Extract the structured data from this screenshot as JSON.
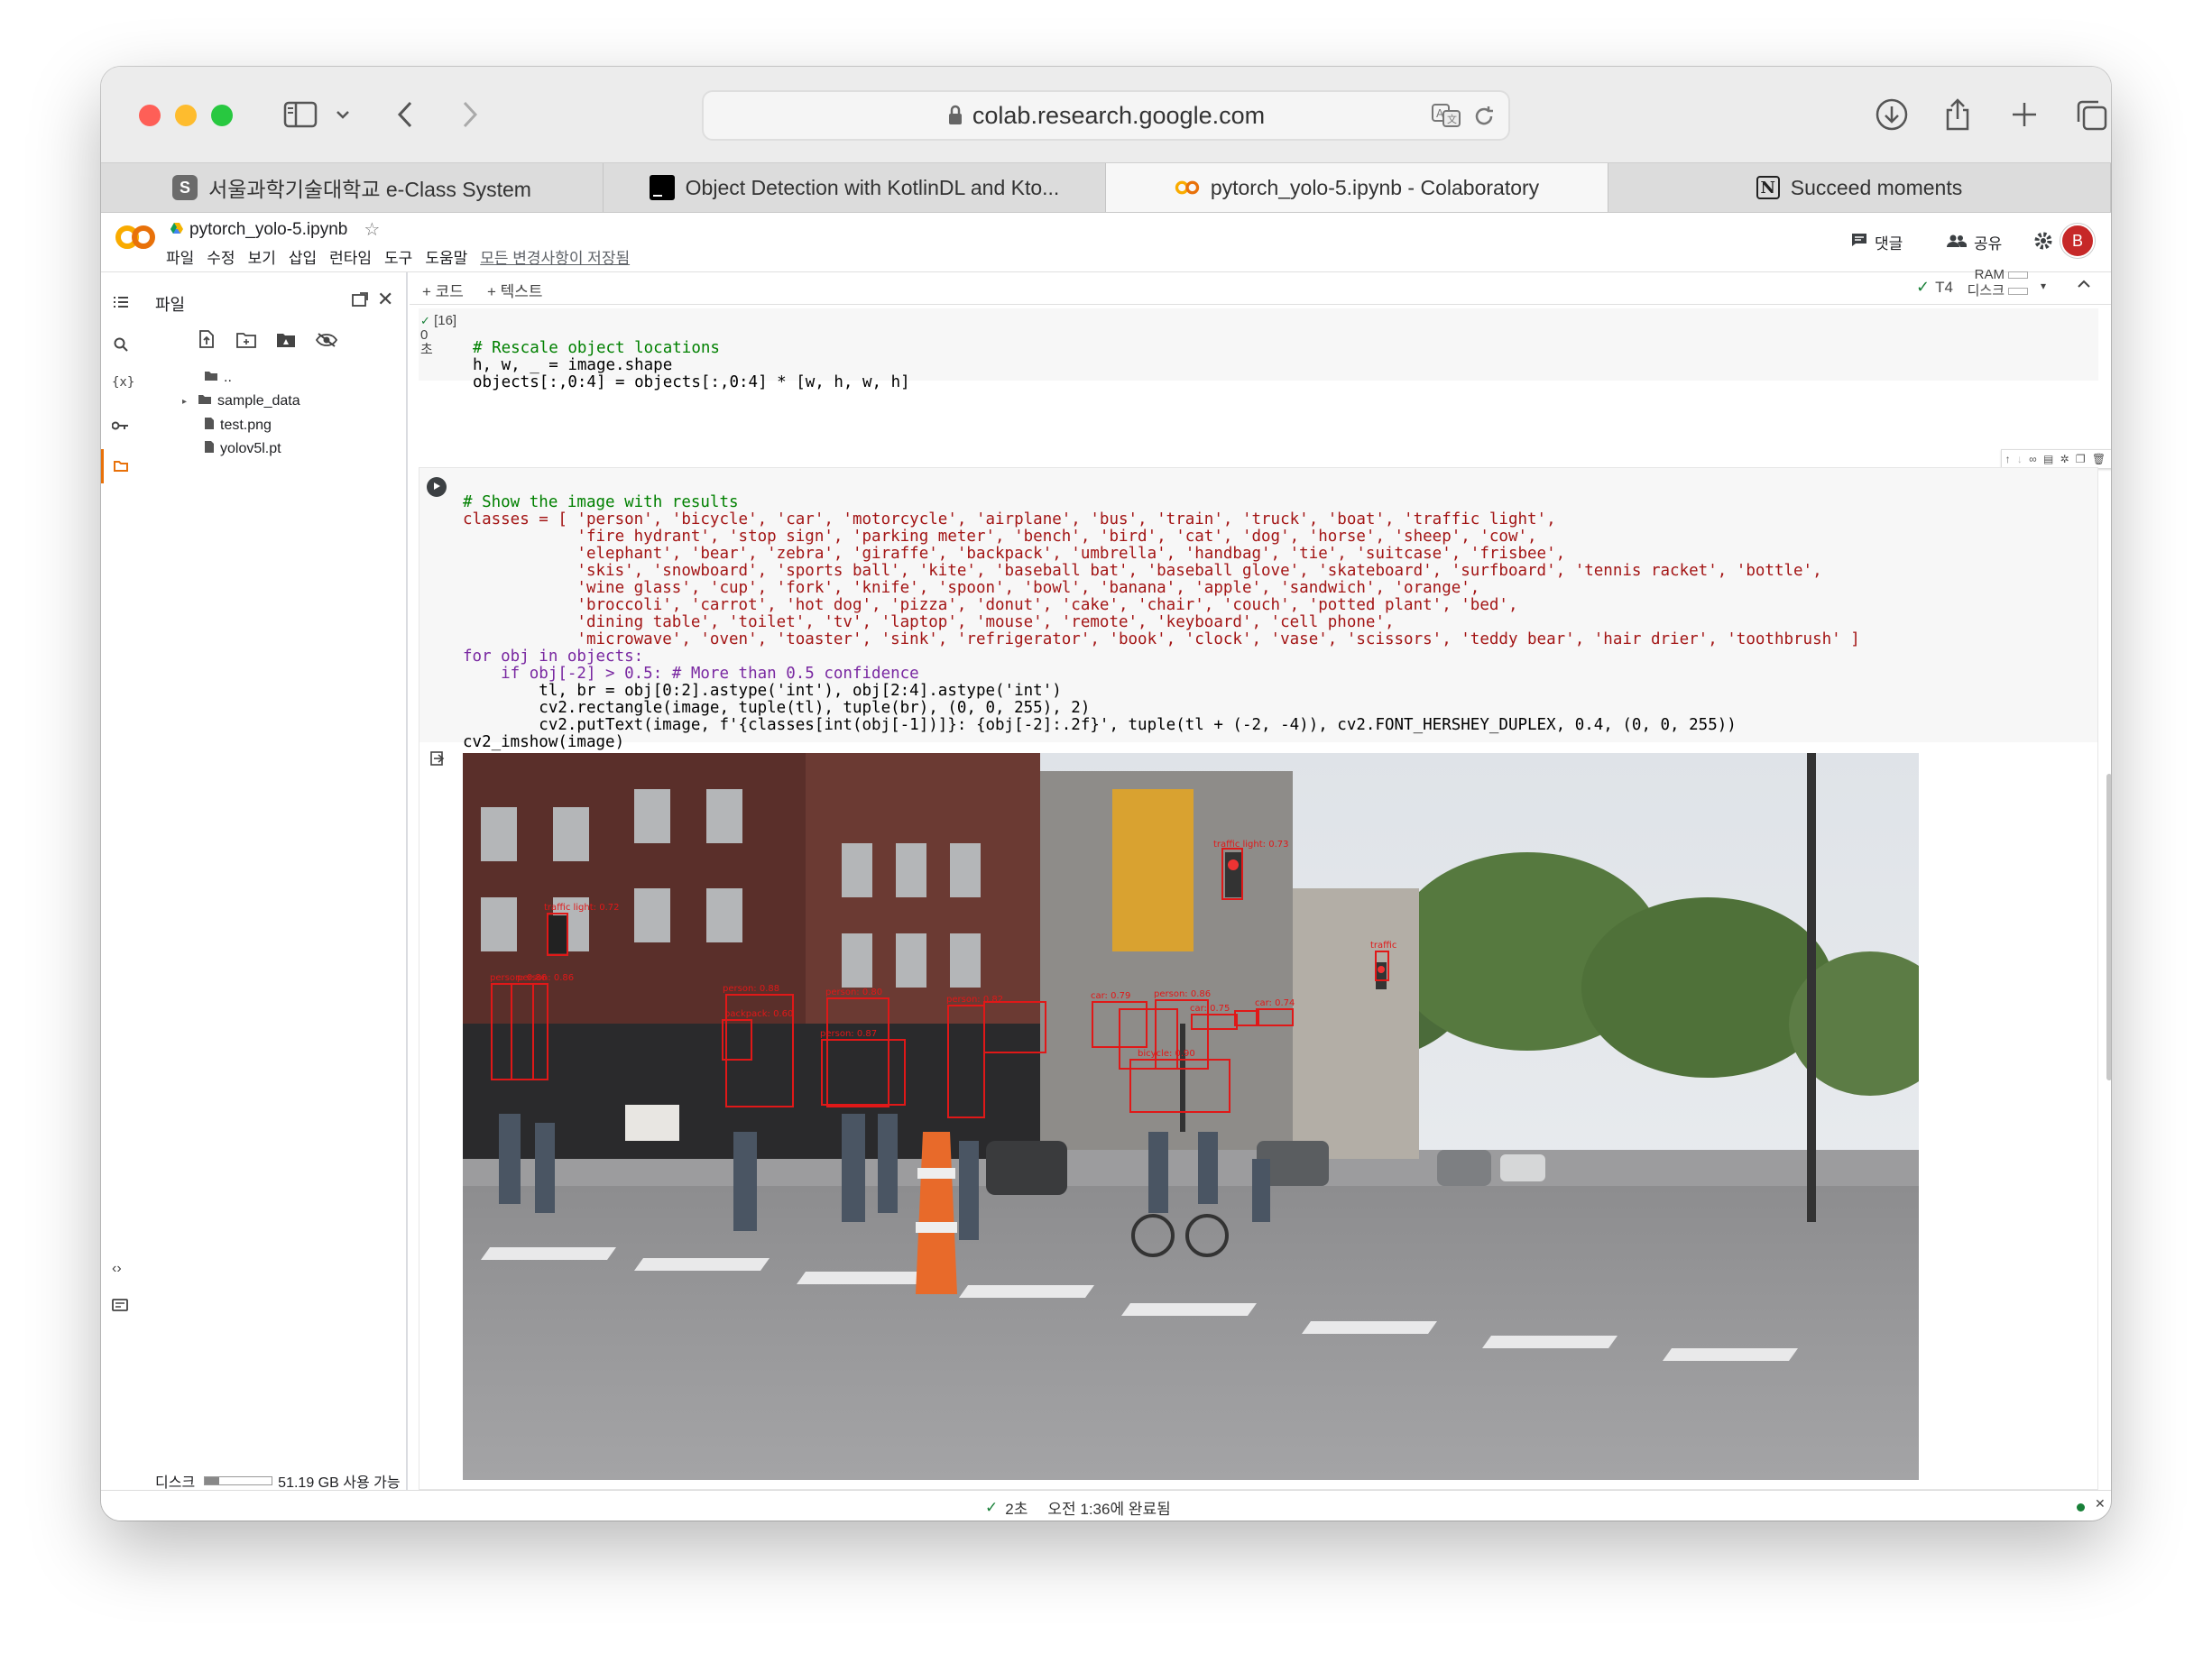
{
  "window": {
    "url": "colab.research.google.com",
    "tabs": [
      {
        "label": "서울과학기술대학교 e-Class System",
        "icon": "s-badge-icon",
        "favicon_text": "S"
      },
      {
        "label": "Object Detection with KotlinDL and Kto...",
        "icon": "terminal-icon"
      },
      {
        "label": "pytorch_yolo-5.ipynb - Colaboratory",
        "icon": "colab-icon"
      },
      {
        "label": "Succeed moments",
        "icon": "notion-icon"
      }
    ]
  },
  "colab": {
    "logo": "CO",
    "notebook_name": "pytorch_yolo-5.ipynb",
    "menu": [
      "파일",
      "수정",
      "보기",
      "삽입",
      "런타임",
      "도구",
      "도움말"
    ],
    "save_status": "모든 변경사항이 저장됨",
    "comment_label": "댓글",
    "share_label": "공유",
    "avatar_letter": "B",
    "add_code": "+ 코드",
    "add_text": "+ 텍스트",
    "runtime": "T4",
    "ram_label": "RAM",
    "disk_label": "디스크"
  },
  "sidebar": {
    "title": "파일",
    "tree": [
      {
        "label": "..",
        "icon": "folder-up-icon"
      },
      {
        "label": "sample_data",
        "icon": "folder-icon"
      },
      {
        "label": "test.png",
        "icon": "file-icon"
      },
      {
        "label": "yolov5l.pt",
        "icon": "file-icon"
      }
    ],
    "disk_label": "디스크",
    "disk_free": "51.19 GB 사용 가능",
    "disk_used_fraction": 0.22
  },
  "cell1": {
    "exec_count": "[16]",
    "duration": "0",
    "duration_unit": "초",
    "lines": [
      "# Rescale object locations",
      "h, w, _ = image.shape",
      "objects[:,0:4] = objects[:,0:4] * [w, h, w, h]"
    ]
  },
  "cell2": {
    "lines": [
      "# Show the image with results",
      "classes = [ 'person', 'bicycle', 'car', 'motorcycle', 'airplane', 'bus', 'train', 'truck', 'boat', 'traffic light',",
      "            'fire hydrant', 'stop sign', 'parking meter', 'bench', 'bird', 'cat', 'dog', 'horse', 'sheep', 'cow',",
      "            'elephant', 'bear', 'zebra', 'giraffe', 'backpack', 'umbrella', 'handbag', 'tie', 'suitcase', 'frisbee',",
      "            'skis', 'snowboard', 'sports ball', 'kite', 'baseball bat', 'baseball glove', 'skateboard', 'surfboard', 'tennis racket', 'bottle',",
      "            'wine glass', 'cup', 'fork', 'knife', 'spoon', 'bowl', 'banana', 'apple', 'sandwich', 'orange',",
      "            'broccoli', 'carrot', 'hot dog', 'pizza', 'donut', 'cake', 'chair', 'couch', 'potted plant', 'bed',",
      "            'dining table', 'toilet', 'tv', 'laptop', 'mouse', 'remote', 'keyboard', 'cell phone',",
      "            'microwave', 'oven', 'toaster', 'sink', 'refrigerator', 'book', 'clock', 'vase', 'scissors', 'teddy bear', 'hair drier', 'toothbrush' ]",
      "for obj in objects:",
      "    if obj[-2] > 0.5: # More than 0.5 confidence",
      "        tl, br = obj[0:2].astype('int'), obj[2:4].astype('int')",
      "        cv2.rectangle(image, tuple(tl), tuple(br), (0, 0, 255), 2)",
      "        cv2.putText(image, f'{classes[int(obj[-1])]}: {obj[-2]:.2f}', tuple(tl + (-2, -4)), cv2.FONT_HERSHEY_DUPLEX, 0.4, (0, 0, 255))",
      "cv2_imshow(image)"
    ]
  },
  "output": {
    "detections": [
      {
        "label": "traffic light: 0.73"
      },
      {
        "label": "traffic light: 0.72"
      },
      {
        "label": "person: 0.86"
      },
      {
        "label": "person: 0.86"
      },
      {
        "label": "person: 0.88"
      },
      {
        "label": "backpack: 0.60"
      },
      {
        "label": "person: 0.80"
      },
      {
        "label": "person: 0.87"
      },
      {
        "label": "person: 0.82"
      },
      {
        "label": "car: 0.79"
      },
      {
        "label": "person: 0.86"
      },
      {
        "label": "car: 0.75"
      },
      {
        "label": "car: 0.74"
      },
      {
        "label": "bicycle: 0.90"
      },
      {
        "label": "traffic"
      }
    ]
  },
  "status": {
    "duration": "2초",
    "completed": "오전 1:36에 완료됨"
  }
}
